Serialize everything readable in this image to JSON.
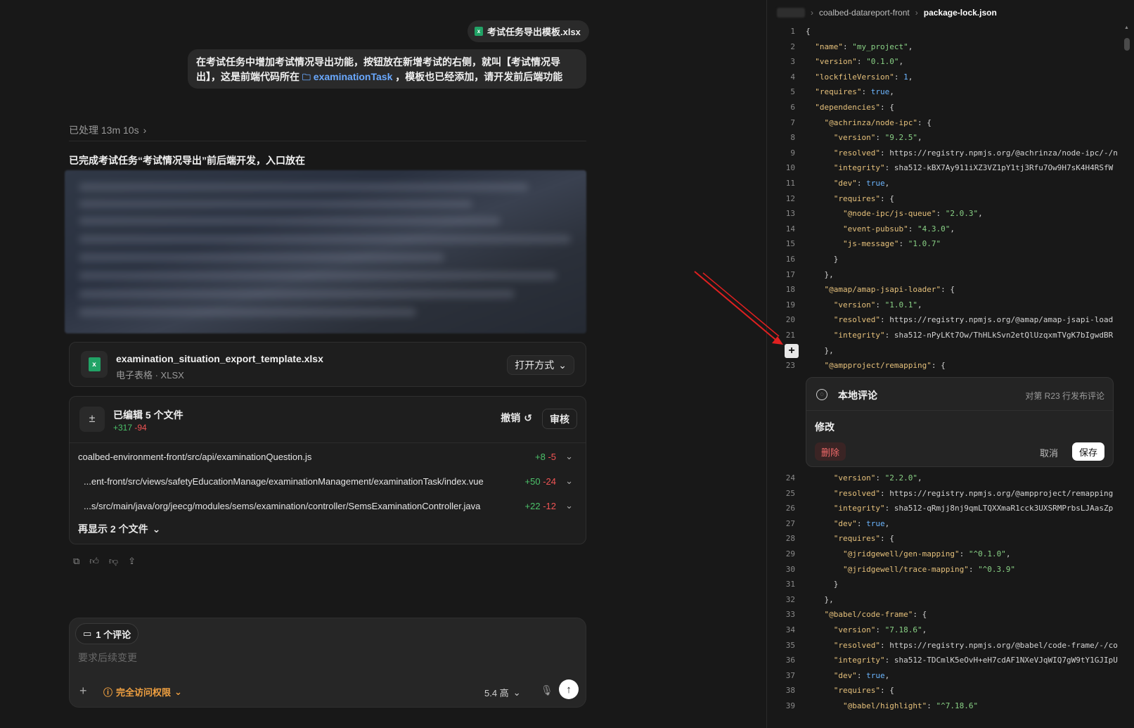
{
  "chat": {
    "attachment_name": "考试任务导出模板.xlsx",
    "user_message_part1": "在考试任务中增加考试情况导出功能，按钮放在新增考试的右侧，就叫【考试情况导",
    "user_message_part2": "出】，这是前端代码所在",
    "user_message_link": "examinationTask",
    "user_message_part3": "，模板也已经添加，请开发前后端功能",
    "processed_label": "已处理 13m 10s",
    "done_text": "已完成考试任务“考试情况导出”前后端开发，入口放在",
    "file_card": {
      "name": "examination_situation_export_template.xlsx",
      "type": "电子表格 · XLSX",
      "open_label": "打开方式"
    },
    "edits": {
      "title": "已编辑 5 个文件",
      "additions": "+317",
      "deletions": "-94",
      "undo_label": "撤销",
      "review_label": "审核",
      "files": [
        {
          "path": "coalbed-environment-front/src/api/examinationQuestion.js",
          "add": "+8",
          "del": "-5"
        },
        {
          "path": "...ent-front/src/views/safetyEducationManage/examinationManagement/examinationTask/index.vue",
          "add": "+50",
          "del": "-24"
        },
        {
          "path": "...s/src/main/java/org/jeecg/modules/sems/examination/controller/SemsExaminationController.java",
          "add": "+22",
          "del": "-12"
        }
      ],
      "more_label": "再显示 2 个文件"
    },
    "composer": {
      "comment_chip": "1 个评论",
      "placeholder": "要求后续变更",
      "access_label": "完全访问权限",
      "model_label": "5.4 高"
    }
  },
  "editor": {
    "breadcrumb": [
      "coalbed-datareport-front",
      "package-lock.json"
    ],
    "comment": {
      "title": "本地评论",
      "meta": "对第 R23 行发布评论",
      "text": "修改",
      "delete_label": "删除",
      "cancel_label": "取消",
      "save_label": "保存"
    },
    "lines_top": [
      {
        "n": "1",
        "t": "{"
      },
      {
        "n": "2",
        "t": "  \"name\": \"my_project\","
      },
      {
        "n": "3",
        "t": "  \"version\": \"0.1.0\","
      },
      {
        "n": "4",
        "t": "  \"lockfileVersion\": 1,"
      },
      {
        "n": "5",
        "t": "  \"requires\": true,"
      },
      {
        "n": "6",
        "t": "  \"dependencies\": {"
      },
      {
        "n": "7",
        "t": "    \"@achrinza/node-ipc\": {"
      },
      {
        "n": "8",
        "t": "      \"version\": \"9.2.5\","
      },
      {
        "n": "9",
        "t": "      \"resolved\": \"https://registry.npmjs.org/@achrinza/node-ipc/-/n"
      },
      {
        "n": "10",
        "t": "      \"integrity\": \"sha512-kBX7Ay911iXZ3VZ1pY1tj3Rfu7Ow9H7sK4H4RSfW"
      },
      {
        "n": "11",
        "t": "      \"dev\": true,"
      },
      {
        "n": "12",
        "t": "      \"requires\": {"
      },
      {
        "n": "13",
        "t": "        \"@node-ipc/js-queue\": \"2.0.3\","
      },
      {
        "n": "14",
        "t": "        \"event-pubsub\": \"4.3.0\","
      },
      {
        "n": "15",
        "t": "        \"js-message\": \"1.0.7\""
      },
      {
        "n": "16",
        "t": "      }"
      },
      {
        "n": "17",
        "t": "    },"
      },
      {
        "n": "18",
        "t": "    \"@amap/amap-jsapi-loader\": {"
      },
      {
        "n": "19",
        "t": "      \"version\": \"1.0.1\","
      },
      {
        "n": "20",
        "t": "      \"resolved\": \"https://registry.npmjs.org/@amap/amap-jsapi-load"
      },
      {
        "n": "21",
        "t": "      \"integrity\": \"sha512-nPyLKt7Ow/ThHLkSvn2etQlUzqxmTVgK7bIgwdBR"
      },
      {
        "n": "",
        "t": "    },"
      },
      {
        "n": "23",
        "t": "    \"@ampproject/remapping\": {"
      }
    ],
    "lines_bottom": [
      {
        "n": "24",
        "t": "      \"version\": \"2.2.0\","
      },
      {
        "n": "25",
        "t": "      \"resolved\": \"https://registry.npmjs.org/@ampproject/remapping"
      },
      {
        "n": "26",
        "t": "      \"integrity\": \"sha512-qRmjj8nj9qmLTQXXmaR1cck3UXSRMPrbsLJAasZp"
      },
      {
        "n": "27",
        "t": "      \"dev\": true,"
      },
      {
        "n": "28",
        "t": "      \"requires\": {"
      },
      {
        "n": "29",
        "t": "        \"@jridgewell/gen-mapping\": \"^0.1.0\","
      },
      {
        "n": "30",
        "t": "        \"@jridgewell/trace-mapping\": \"^0.3.9\""
      },
      {
        "n": "31",
        "t": "      }"
      },
      {
        "n": "32",
        "t": "    },"
      },
      {
        "n": "33",
        "t": "    \"@babel/code-frame\": {"
      },
      {
        "n": "34",
        "t": "      \"version\": \"7.18.6\","
      },
      {
        "n": "35",
        "t": "      \"resolved\": \"https://registry.npmjs.org/@babel/code-frame/-/co"
      },
      {
        "n": "36",
        "t": "      \"integrity\": \"sha512-TDCmlK5eOvH+eH7cdAF1NXeVJqWIQ7gW9tY1GJIpU"
      },
      {
        "n": "37",
        "t": "      \"dev\": true,"
      },
      {
        "n": "38",
        "t": "      \"requires\": {"
      },
      {
        "n": "39",
        "t": "        \"@babel/highlight\": \"^7.18.6\""
      }
    ]
  }
}
